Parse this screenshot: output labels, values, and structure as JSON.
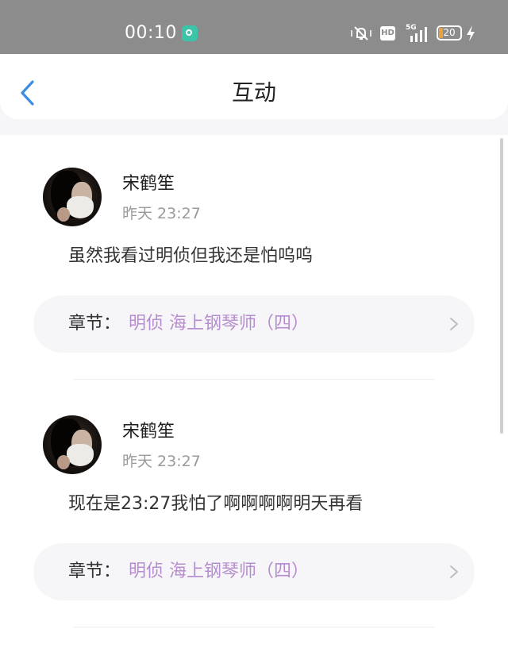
{
  "status_bar": {
    "time": "00:10",
    "network": "5G",
    "hd": "HD",
    "battery": "20"
  },
  "header": {
    "title": "互动"
  },
  "comments": [
    {
      "user": "宋鹤笙",
      "time": "昨天 23:27",
      "text": "虽然我看过明侦但我还是怕呜呜",
      "chapter_label": "章节：",
      "chapter_name": "明侦 海上钢琴师（四）"
    },
    {
      "user": "宋鹤笙",
      "time": "昨天 23:27",
      "text": "现在是23:27我怕了啊啊啊啊明天再看",
      "chapter_label": "章节：",
      "chapter_name": "明侦 海上钢琴师（四）"
    }
  ],
  "colors": {
    "status_bar": "#8c8c8c",
    "accent_back": "#3b8de4",
    "chapter_name": "#b78cd0"
  }
}
